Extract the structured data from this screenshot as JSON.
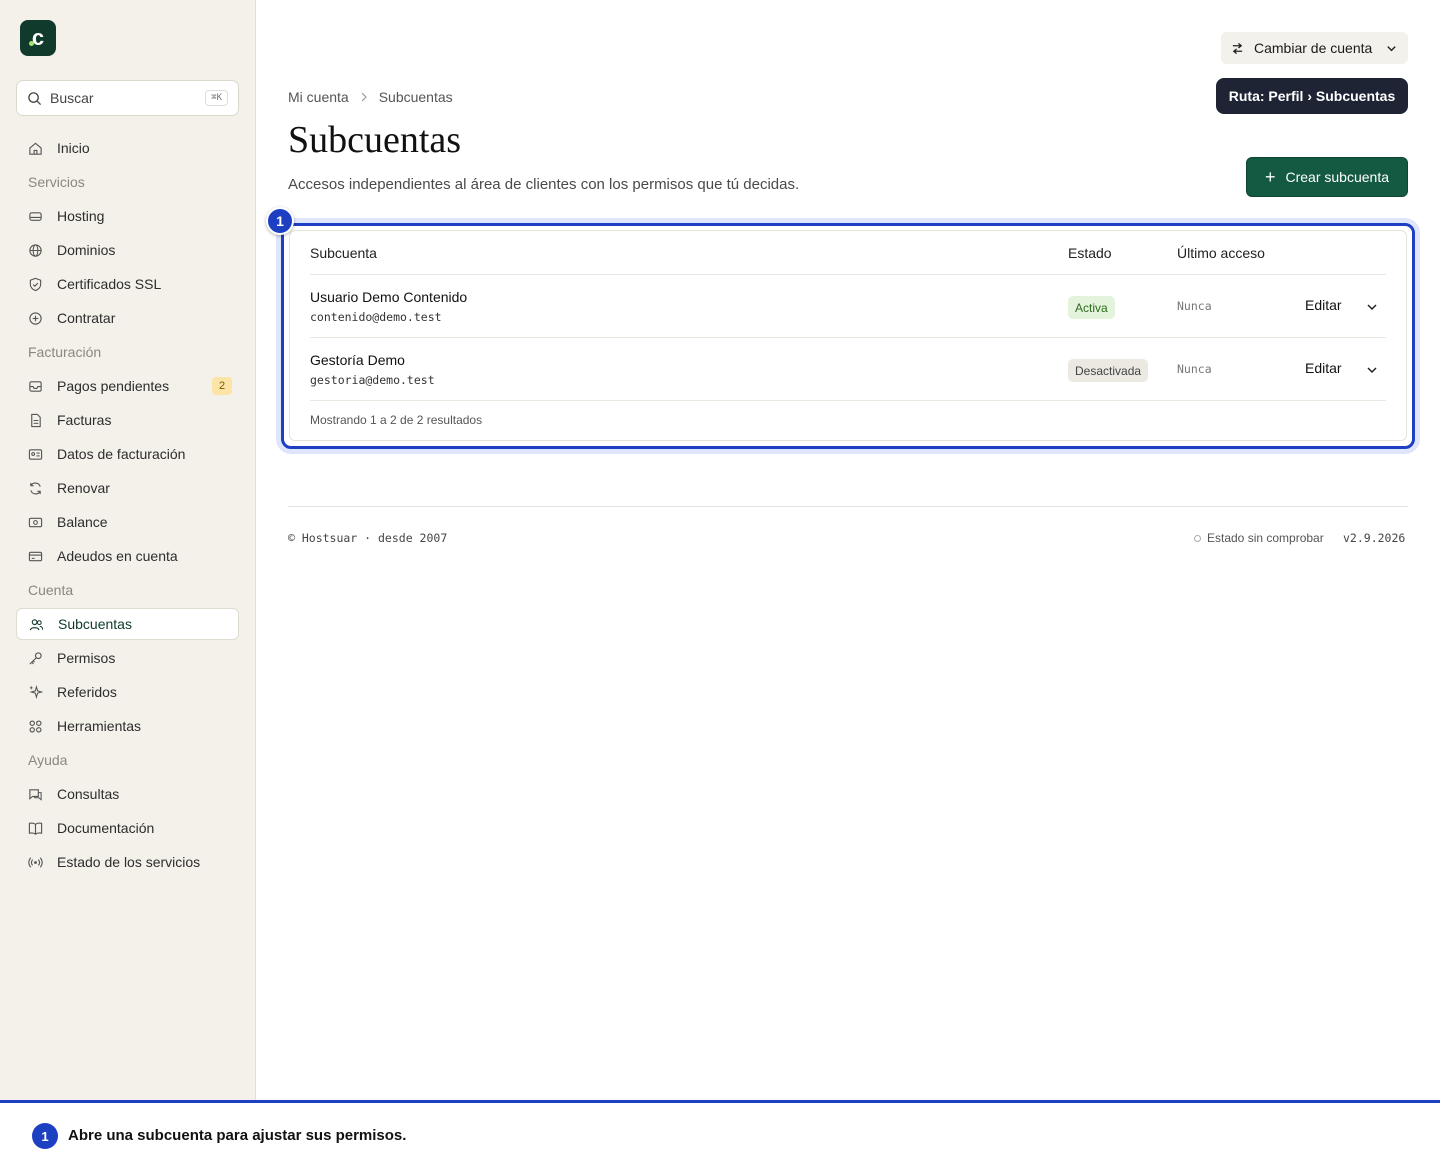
{
  "sidebar": {
    "logo_letter": "c",
    "search": {
      "placeholder": "Buscar",
      "shortcut": "⌘K"
    },
    "items": [
      {
        "type": "item",
        "label": "Inicio",
        "icon": "home-icon"
      },
      {
        "type": "section",
        "label": "Servicios"
      },
      {
        "type": "item",
        "label": "Hosting",
        "icon": "server-icon"
      },
      {
        "type": "item",
        "label": "Dominios",
        "icon": "globe-icon"
      },
      {
        "type": "item",
        "label": "Certificados SSL",
        "icon": "shield-icon"
      },
      {
        "type": "item",
        "label": "Contratar",
        "icon": "plus-circle-icon"
      },
      {
        "type": "section",
        "label": "Facturación"
      },
      {
        "type": "item",
        "label": "Pagos pendientes",
        "icon": "inbox-icon",
        "badge": "2"
      },
      {
        "type": "item",
        "label": "Facturas",
        "icon": "file-icon"
      },
      {
        "type": "item",
        "label": "Datos de facturación",
        "icon": "id-card-icon"
      },
      {
        "type": "item",
        "label": "Renovar",
        "icon": "refresh-icon"
      },
      {
        "type": "item",
        "label": "Balance",
        "icon": "banknote-icon"
      },
      {
        "type": "item",
        "label": "Adeudos en cuenta",
        "icon": "credit-card-icon"
      },
      {
        "type": "section",
        "label": "Cuenta"
      },
      {
        "type": "item",
        "label": "Subcuentas",
        "icon": "users-icon",
        "active": true
      },
      {
        "type": "item",
        "label": "Permisos",
        "icon": "key-icon"
      },
      {
        "type": "item",
        "label": "Referidos",
        "icon": "sparkles-icon"
      },
      {
        "type": "item",
        "label": "Herramientas",
        "icon": "grid-icon"
      },
      {
        "type": "section",
        "label": "Ayuda"
      },
      {
        "type": "item",
        "label": "Consultas",
        "icon": "chat-icon"
      },
      {
        "type": "item",
        "label": "Documentación",
        "icon": "book-icon"
      },
      {
        "type": "item",
        "label": "Estado de los servicios",
        "icon": "broadcast-icon"
      }
    ]
  },
  "header": {
    "switch_account": "Cambiar de cuenta",
    "tooltip": "Ruta: Perfil › Subcuentas"
  },
  "breadcrumb": [
    "Mi cuenta",
    "Subcuentas"
  ],
  "page": {
    "title": "Subcuentas",
    "subtitle": "Accesos independientes al área de clientes con los permisos que tú decidas.",
    "create_button": "Crear subcuenta"
  },
  "table": {
    "columns": {
      "account": "Subcuenta",
      "status": "Estado",
      "last_access": "Último acceso"
    },
    "rows": [
      {
        "name": "Usuario Demo Contenido",
        "email": "contenido@demo.test",
        "status": "Activa",
        "status_kind": "active",
        "last_access": "Nunca",
        "action": "Editar"
      },
      {
        "name": "Gestoría Demo",
        "email": "gestoria@demo.test",
        "status": "Desactivada",
        "status_kind": "inactive",
        "last_access": "Nunca",
        "action": "Editar"
      }
    ],
    "footer": "Mostrando 1 a 2 de 2 resultados"
  },
  "highlight": {
    "step": "1"
  },
  "footer": {
    "copyright": "© Hostsuar · desde 2007",
    "status": "Estado sin comprobar",
    "version": "v2.9.2026"
  },
  "instruction": {
    "step": "1",
    "text": "Abre una subcuenta para ajustar sus permisos."
  },
  "colors": {
    "brand": "#145a43",
    "highlight": "#1d3fc2",
    "sidebar_bg": "#f4f1ea"
  }
}
